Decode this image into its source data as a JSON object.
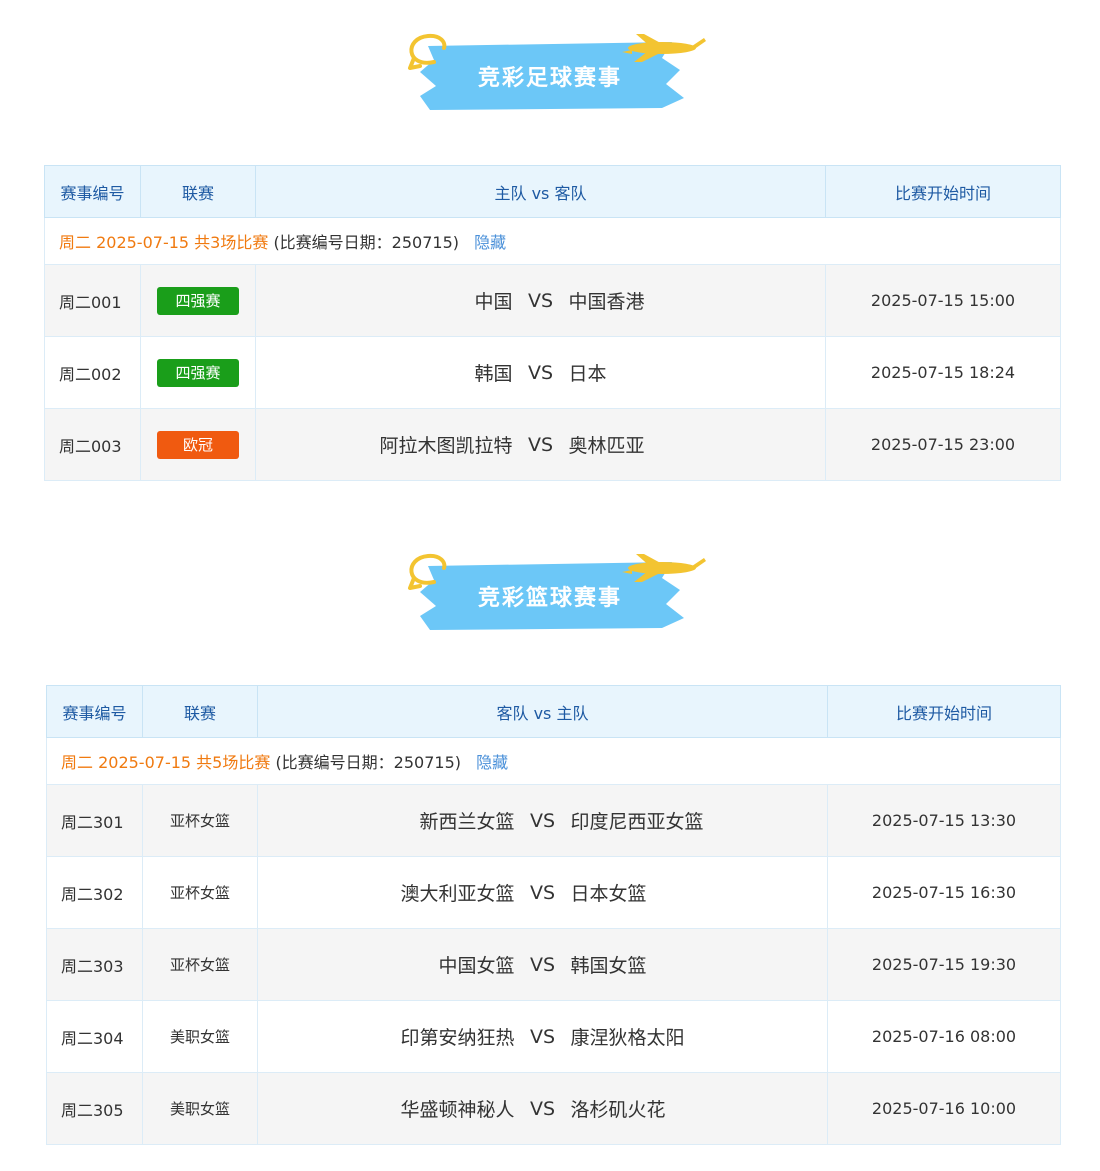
{
  "colors": {
    "banner": "#6cc7f7",
    "header_bg": "#e8f5fd",
    "header_text": "#1e5aa3",
    "day_label": "#f07a10",
    "link": "#4a90d9"
  },
  "football": {
    "banner_title": "竞彩足球赛事",
    "headers": {
      "code": "赛事编号",
      "league": "联赛",
      "teams": "主队 vs 客队",
      "time": "比赛开始时间"
    },
    "day": {
      "label": "周二 2025-07-15 共3场比赛",
      "note": "(比赛编号日期：250715)",
      "toggle": "隐藏"
    },
    "matches": [
      {
        "code": "周二001",
        "league": "四强赛",
        "league_color": "#1a9e1a",
        "home": "中国",
        "vs": "VS",
        "away": "中国香港",
        "time": "2025-07-15 15:00"
      },
      {
        "code": "周二002",
        "league": "四强赛",
        "league_color": "#1a9e1a",
        "home": "韩国",
        "vs": "VS",
        "away": "日本",
        "time": "2025-07-15 18:24"
      },
      {
        "code": "周二003",
        "league": "欧冠",
        "league_color": "#f05a10",
        "home": "阿拉木图凯拉特",
        "vs": "VS",
        "away": "奥林匹亚",
        "time": "2025-07-15 23:00"
      }
    ]
  },
  "basketball": {
    "banner_title": "竞彩篮球赛事",
    "headers": {
      "code": "赛事编号",
      "league": "联赛",
      "teams": "客队 vs 主队",
      "time": "比赛开始时间"
    },
    "day": {
      "label": "周二 2025-07-15 共5场比赛",
      "note": "(比赛编号日期：250715)",
      "toggle": "隐藏"
    },
    "matches": [
      {
        "code": "周二301",
        "league": "亚杯女篮",
        "away": "新西兰女篮",
        "vs": "VS",
        "home": "印度尼西亚女篮",
        "time": "2025-07-15 13:30"
      },
      {
        "code": "周二302",
        "league": "亚杯女篮",
        "away": "澳大利亚女篮",
        "vs": "VS",
        "home": "日本女篮",
        "time": "2025-07-15 16:30"
      },
      {
        "code": "周二303",
        "league": "亚杯女篮",
        "away": "中国女篮",
        "vs": "VS",
        "home": "韩国女篮",
        "time": "2025-07-15 19:30"
      },
      {
        "code": "周二304",
        "league": "美职女篮",
        "away": "印第安纳狂热",
        "vs": "VS",
        "home": "康涅狄格太阳",
        "time": "2025-07-16 08:00"
      },
      {
        "code": "周二305",
        "league": "美职女篮",
        "away": "华盛顿神秘人",
        "vs": "VS",
        "home": "洛杉矶火花",
        "time": "2025-07-16 10:00"
      }
    ]
  }
}
